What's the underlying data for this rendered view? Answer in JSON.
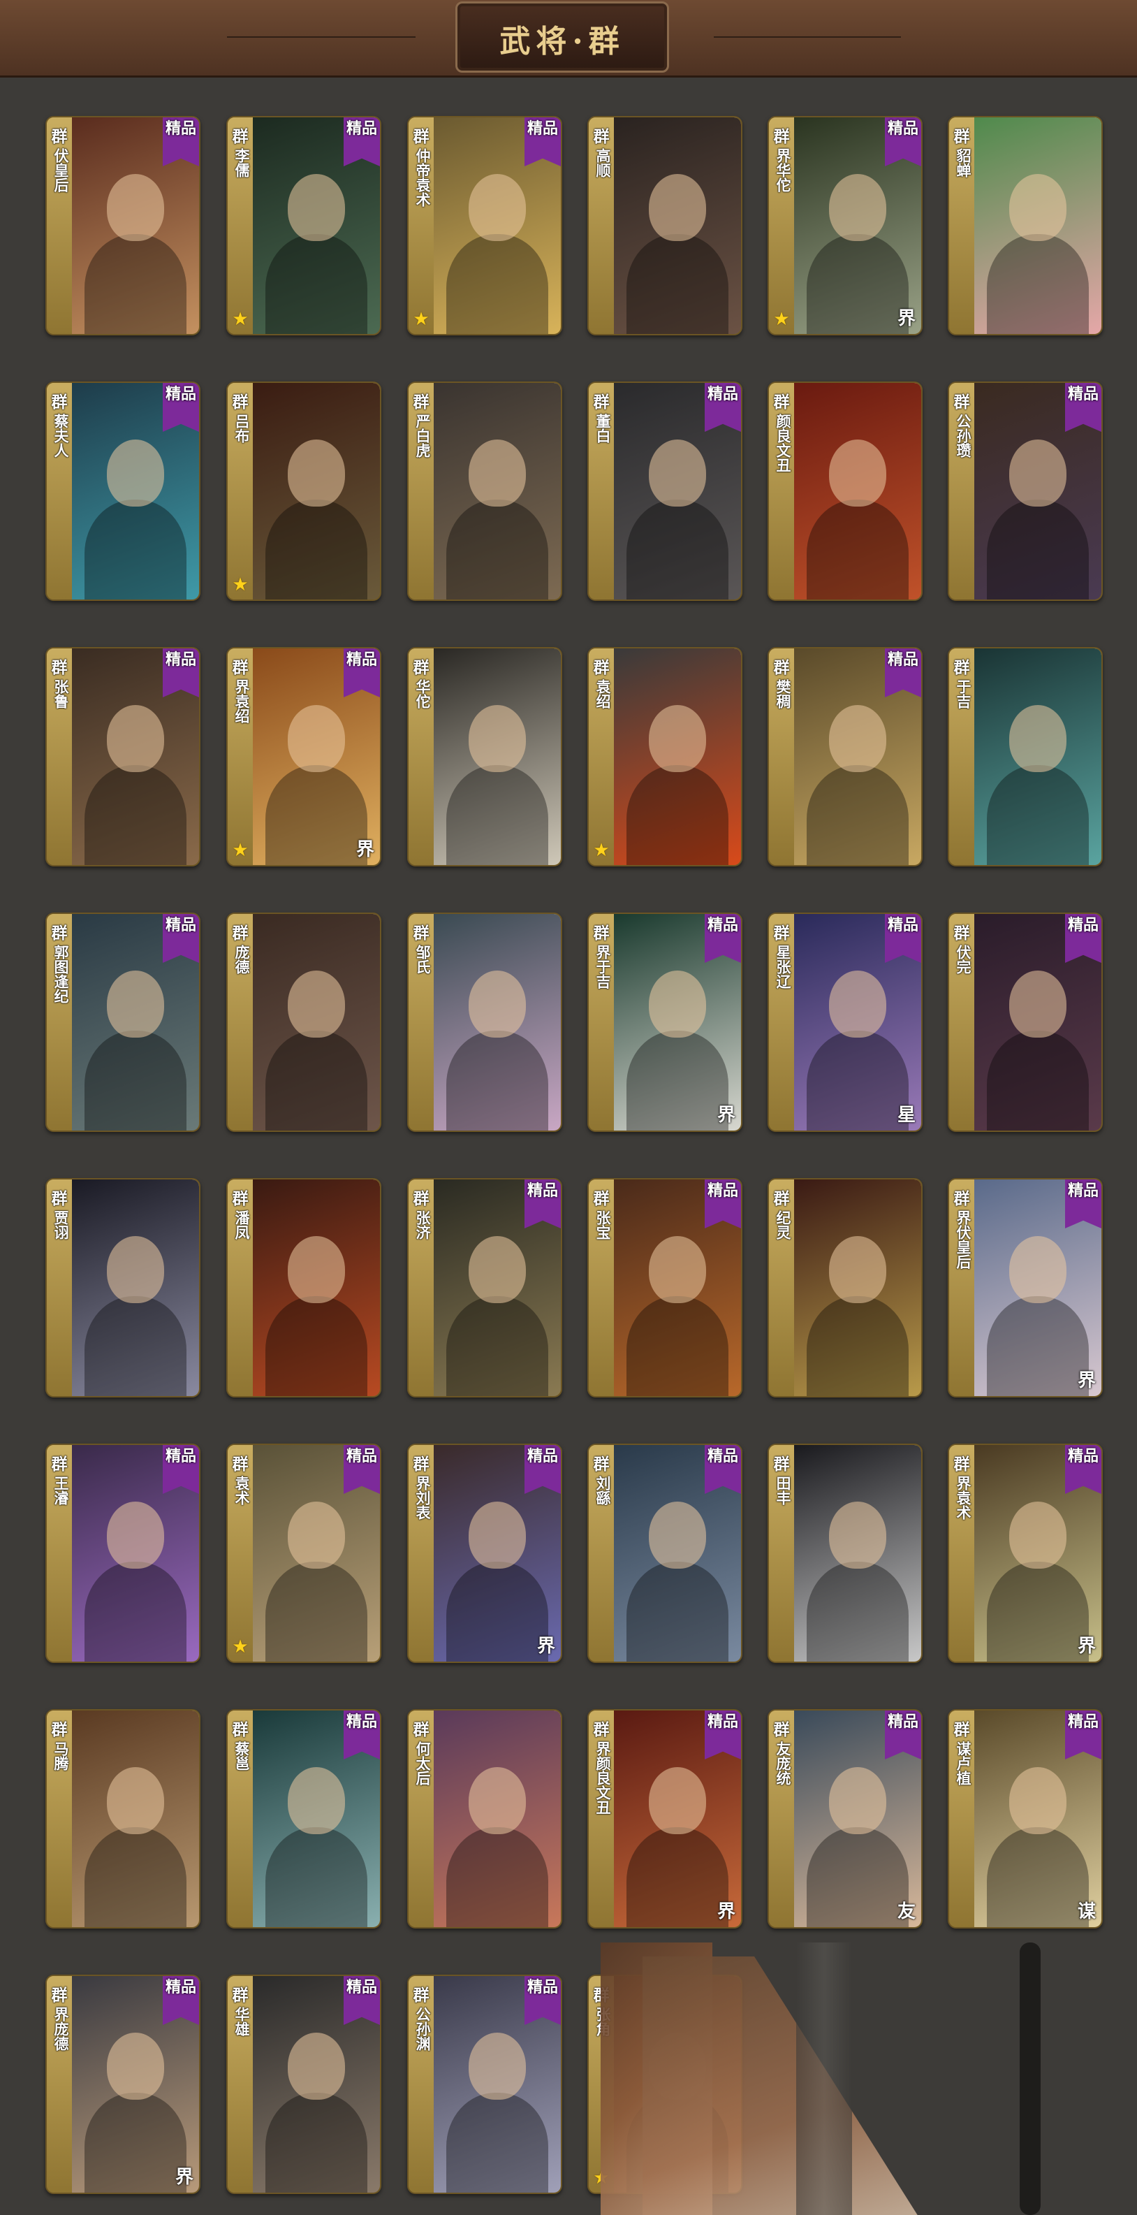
{
  "header": {
    "title": "武将·群"
  },
  "badge_label": "精品",
  "cards": [
    {
      "faction": "群",
      "name": "伏皇后",
      "premium": true,
      "star": false,
      "mark": "",
      "bg": [
        "#5a2c1e",
        "#c49160"
      ]
    },
    {
      "faction": "群",
      "name": "李儒",
      "premium": true,
      "star": true,
      "mark": "",
      "bg": [
        "#1c2a20",
        "#4c6a52"
      ]
    },
    {
      "faction": "群",
      "name": "仲帝袁术",
      "premium": true,
      "star": true,
      "mark": "",
      "bg": [
        "#6b5a30",
        "#d8b35a"
      ]
    },
    {
      "faction": "群",
      "name": "高顺",
      "premium": false,
      "star": false,
      "mark": "",
      "bg": [
        "#2a2320",
        "#6b5244"
      ]
    },
    {
      "faction": "群",
      "name": "界华佗",
      "premium": true,
      "star": true,
      "mark": "界",
      "bg": [
        "#2a3420",
        "#9aa287"
      ]
    },
    {
      "faction": "群",
      "name": "貂蝉",
      "premium": false,
      "star": false,
      "mark": "",
      "bg": [
        "#4f8a4c",
        "#e5a7a8"
      ]
    },
    {
      "faction": "群",
      "name": "蔡夫人",
      "premium": true,
      "star": false,
      "mark": "",
      "bg": [
        "#1e3c4a",
        "#3f9aa8"
      ]
    },
    {
      "faction": "群",
      "name": "吕布",
      "premium": false,
      "star": true,
      "mark": "",
      "bg": [
        "#3a1c12",
        "#6a5a3a"
      ]
    },
    {
      "faction": "群",
      "name": "严白虎",
      "premium": false,
      "star": false,
      "mark": "",
      "bg": [
        "#3a3430",
        "#7d6a52"
      ]
    },
    {
      "faction": "群",
      "name": "董白",
      "premium": true,
      "star": false,
      "mark": "",
      "bg": [
        "#2a2a2c",
        "#5a5656"
      ]
    },
    {
      "faction": "群",
      "name": "颜良文丑",
      "premium": false,
      "star": false,
      "mark": "",
      "bg": [
        "#6a1a10",
        "#c0522a"
      ]
    },
    {
      "faction": "群",
      "name": "公孙瓒",
      "premium": true,
      "star": false,
      "mark": "",
      "bg": [
        "#3a2a20",
        "#4a3a52"
      ]
    },
    {
      "faction": "群",
      "name": "张鲁",
      "premium": true,
      "star": false,
      "mark": "",
      "bg": [
        "#3a2c22",
        "#8a6a4a"
      ]
    },
    {
      "faction": "群",
      "name": "界袁绍",
      "premium": true,
      "star": true,
      "mark": "界",
      "bg": [
        "#8a4a1a",
        "#e0b060"
      ]
    },
    {
      "faction": "群",
      "name": "华佗",
      "premium": false,
      "star": false,
      "mark": "",
      "bg": [
        "#2a2824",
        "#cfc8b8"
      ]
    },
    {
      "faction": "群",
      "name": "袁绍",
      "premium": false,
      "star": true,
      "mark": "",
      "bg": [
        "#3a3a3a",
        "#d84a1a"
      ]
    },
    {
      "faction": "群",
      "name": "樊稠",
      "premium": true,
      "star": false,
      "mark": "",
      "bg": [
        "#5a4a2a",
        "#c8a862"
      ]
    },
    {
      "faction": "群",
      "name": "于吉",
      "premium": false,
      "star": false,
      "mark": "",
      "bg": [
        "#1a3434",
        "#5aa4a0"
      ]
    },
    {
      "faction": "群",
      "name": "郭图逢纪",
      "premium": true,
      "star": false,
      "mark": "",
      "bg": [
        "#2a3a44",
        "#6a7a78"
      ]
    },
    {
      "faction": "群",
      "name": "庞德",
      "premium": false,
      "star": false,
      "mark": "",
      "bg": [
        "#3a2a22",
        "#6e564a"
      ]
    },
    {
      "faction": "群",
      "name": "邹氏",
      "premium": false,
      "star": false,
      "mark": "",
      "bg": [
        "#3a4a52",
        "#c9a7c4"
      ]
    },
    {
      "faction": "群",
      "name": "界于吉",
      "premium": true,
      "star": false,
      "mark": "界",
      "bg": [
        "#1a3a2e",
        "#d8d8d0"
      ]
    },
    {
      "faction": "群",
      "name": "星张辽",
      "premium": true,
      "star": false,
      "mark": "星",
      "bg": [
        "#2a2a5a",
        "#9a7ab8"
      ]
    },
    {
      "faction": "群",
      "name": "伏完",
      "premium": true,
      "star": false,
      "mark": "",
      "bg": [
        "#2a1c2a",
        "#5a3a4a"
      ]
    },
    {
      "faction": "群",
      "name": "贾诩",
      "premium": false,
      "star": false,
      "mark": "",
      "bg": [
        "#1a1a24",
        "#8a8aa0"
      ]
    },
    {
      "faction": "群",
      "name": "潘凤",
      "premium": false,
      "star": false,
      "mark": "",
      "bg": [
        "#3a1a12",
        "#b84a22"
      ]
    },
    {
      "faction": "群",
      "name": "张济",
      "premium": true,
      "star": false,
      "mark": "",
      "bg": [
        "#2a2a22",
        "#8a7a52"
      ]
    },
    {
      "faction": "群",
      "name": "张宝",
      "premium": true,
      "star": false,
      "mark": "",
      "bg": [
        "#4a2a1a",
        "#b8682a"
      ]
    },
    {
      "faction": "群",
      "name": "纪灵",
      "premium": false,
      "star": false,
      "mark": "",
      "bg": [
        "#3a1a14",
        "#b89a4a"
      ]
    },
    {
      "faction": "群",
      "name": "界伏皇后",
      "premium": true,
      "star": false,
      "mark": "界",
      "bg": [
        "#5a6a8a",
        "#d8c8d0"
      ]
    },
    {
      "faction": "群",
      "name": "王濬",
      "premium": true,
      "star": false,
      "mark": "",
      "bg": [
        "#3a2a4a",
        "#9a6ac0"
      ]
    },
    {
      "faction": "群",
      "name": "袁术",
      "premium": true,
      "star": true,
      "mark": "",
      "bg": [
        "#5a5238",
        "#b8a078"
      ]
    },
    {
      "faction": "群",
      "name": "界刘表",
      "premium": true,
      "star": false,
      "mark": "界",
      "bg": [
        "#3a2a2a",
        "#6a6ab0"
      ]
    },
    {
      "faction": "群",
      "name": "刘繇",
      "premium": true,
      "star": false,
      "mark": "",
      "bg": [
        "#2a3a4a",
        "#7a8aa0"
      ]
    },
    {
      "faction": "群",
      "name": "田丰",
      "premium": false,
      "star": false,
      "mark": "",
      "bg": [
        "#1a1a1e",
        "#c8c8c8"
      ]
    },
    {
      "faction": "群",
      "name": "界袁术",
      "premium": true,
      "star": false,
      "mark": "界",
      "bg": [
        "#4a3a22",
        "#c8c08a"
      ]
    },
    {
      "faction": "群",
      "name": "马腾",
      "premium": false,
      "star": false,
      "mark": "",
      "bg": [
        "#5a3a22",
        "#b89870"
      ]
    },
    {
      "faction": "群",
      "name": "蔡邕",
      "premium": true,
      "star": false,
      "mark": "",
      "bg": [
        "#1a3a3a",
        "#8ab0b0"
      ]
    },
    {
      "faction": "群",
      "name": "何太后",
      "premium": false,
      "star": false,
      "mark": "",
      "bg": [
        "#5a3a5a",
        "#c8785a"
      ]
    },
    {
      "faction": "群",
      "name": "界颜良文丑",
      "premium": true,
      "star": false,
      "mark": "界",
      "bg": [
        "#5a1a12",
        "#c86a3a"
      ]
    },
    {
      "faction": "群",
      "name": "友庞统",
      "premium": true,
      "star": false,
      "mark": "友",
      "bg": [
        "#3a4a5a",
        "#d8b89a"
      ]
    },
    {
      "faction": "群",
      "name": "谋卢植",
      "premium": true,
      "star": false,
      "mark": "谋",
      "bg": [
        "#5a4a2a",
        "#e0d0a0"
      ]
    },
    {
      "faction": "群",
      "name": "界庞德",
      "premium": true,
      "star": false,
      "mark": "界",
      "bg": [
        "#3a3a40",
        "#b89a7a"
      ]
    },
    {
      "faction": "群",
      "name": "华雄",
      "premium": true,
      "star": false,
      "mark": "",
      "bg": [
        "#2a2a2a",
        "#8a7a6a"
      ]
    },
    {
      "faction": "群",
      "name": "公孙渊",
      "premium": true,
      "star": false,
      "mark": "",
      "bg": [
        "#3a3a4a",
        "#a0a0b8"
      ]
    },
    {
      "faction": "群",
      "name": "张角",
      "premium": false,
      "star": true,
      "mark": "",
      "bg": [
        "#6a3a22",
        "#b87a4a"
      ]
    }
  ]
}
